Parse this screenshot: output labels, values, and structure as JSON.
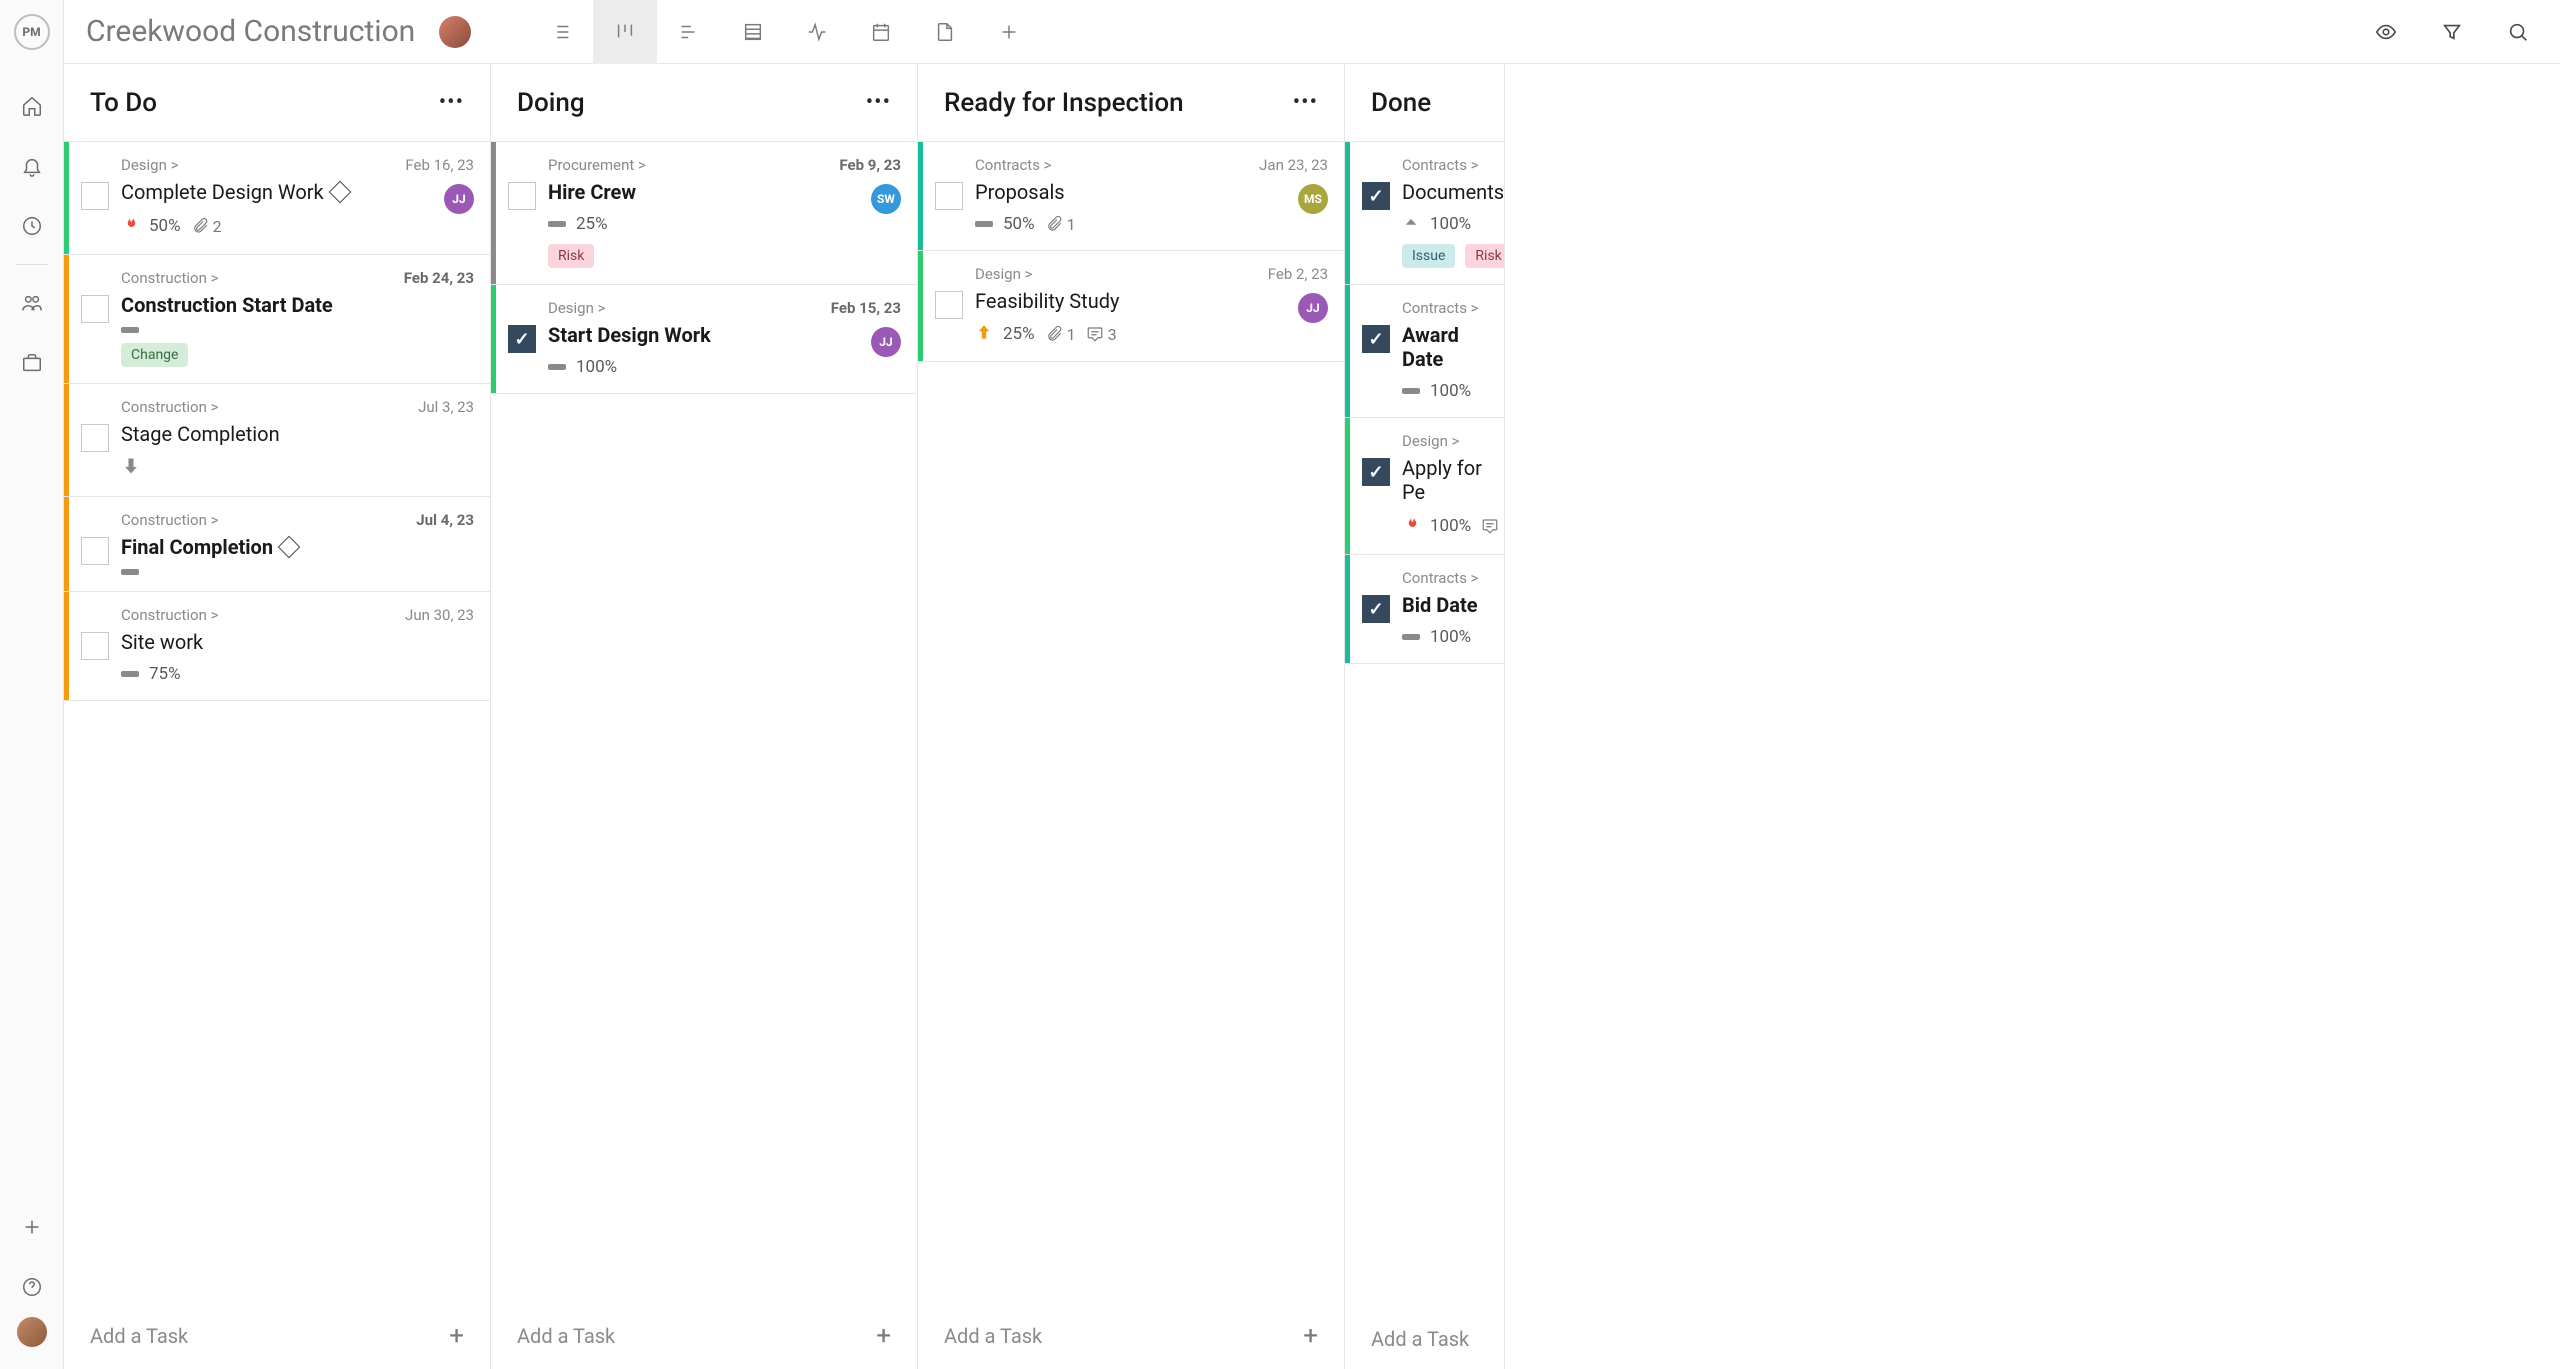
{
  "project_title": "Creekwood Construction",
  "columns": [
    {
      "title": "To Do",
      "add_label": "Add a Task",
      "cards": [
        {
          "crumb": "Design >",
          "title": "Complete Design Work",
          "date": "Feb 16, 23",
          "bold": false,
          "bar": "#2ecc71",
          "pct": "50%",
          "attach": "2",
          "diamond": true,
          "priority": "flame",
          "avatar": {
            "text": "JJ",
            "bg": "#9b59b6"
          }
        },
        {
          "crumb": "Construction >",
          "title": "Construction Start Date",
          "date": "Feb 24, 23",
          "bold": true,
          "date_bold": true,
          "bar": "#f39c12",
          "priority": "bar",
          "tags": [
            {
              "text": "Change",
              "cls": "change"
            }
          ]
        },
        {
          "crumb": "Construction >",
          "title": "Stage Completion",
          "date": "Jul 3, 23",
          "bar": "#f39c12",
          "priority": "arrow-down-gray"
        },
        {
          "crumb": "Construction >",
          "title": "Final Completion",
          "date": "Jul 4, 23",
          "bold": true,
          "date_bold": true,
          "bar": "#f39c12",
          "diamond": true,
          "priority": "bar"
        },
        {
          "crumb": "Construction >",
          "title": "Site work",
          "date": "Jun 30, 23",
          "bar": "#f39c12",
          "pct": "75%",
          "priority": "bar"
        }
      ]
    },
    {
      "title": "Doing",
      "add_label": "Add a Task",
      "cards": [
        {
          "crumb": "Procurement >",
          "title": "Hire Crew",
          "date": "Feb 9, 23",
          "bold": true,
          "date_bold": true,
          "bar": "#8a8a8a",
          "pct": "25%",
          "priority": "bar",
          "tags": [
            {
              "text": "Risk",
              "cls": "risk"
            }
          ],
          "avatar": {
            "text": "SW",
            "bg": "#3498db"
          }
        },
        {
          "crumb": "Design >",
          "title": "Start Design Work",
          "date": "Feb 15, 23",
          "bold": true,
          "date_bold": true,
          "bar": "#2ecc71",
          "pct": "100%",
          "priority": "bar",
          "checked": true,
          "avatar": {
            "text": "JJ",
            "bg": "#9b59b6"
          }
        }
      ]
    },
    {
      "title": "Ready for Inspection",
      "add_label": "Add a Task",
      "cards": [
        {
          "crumb": "Contracts >",
          "title": "Proposals",
          "date": "Jan 23, 23",
          "bar": "#1abc9c",
          "pct": "50%",
          "attach": "1",
          "priority": "bar",
          "avatar": {
            "text": "MS",
            "bg": "#a8a63e"
          }
        },
        {
          "crumb": "Design >",
          "title": "Feasibility Study",
          "date": "Feb 2, 23",
          "bar": "#2ecc71",
          "pct": "25%",
          "attach": "1",
          "comments": "3",
          "priority": "arrow-up",
          "avatar": {
            "text": "JJ",
            "bg": "#9b59b6"
          }
        }
      ]
    },
    {
      "title": "Done",
      "add_label": "Add a Task",
      "narrow": true,
      "cards": [
        {
          "crumb": "Contracts >",
          "title": "Documents",
          "bar": "#1abc9c",
          "pct": "100%",
          "checked": true,
          "priority": "arrow-up-gray",
          "tags": [
            {
              "text": "Issue",
              "cls": "issue"
            },
            {
              "text": "Risk",
              "cls": "risk"
            }
          ]
        },
        {
          "crumb": "Contracts >",
          "title": "Award Date",
          "bold": true,
          "bar": "#1abc9c",
          "pct": "100%",
          "checked": true,
          "priority": "bar"
        },
        {
          "crumb": "Design >",
          "title": "Apply for Pe",
          "bar": "#2ecc71",
          "pct": "100%",
          "checked": true,
          "priority": "flame",
          "has_comment_icon": true
        },
        {
          "crumb": "Contracts >",
          "title": "Bid Date",
          "bold": true,
          "bar": "#1abc9c",
          "pct": "100%",
          "checked": true,
          "priority": "bar"
        }
      ]
    }
  ]
}
